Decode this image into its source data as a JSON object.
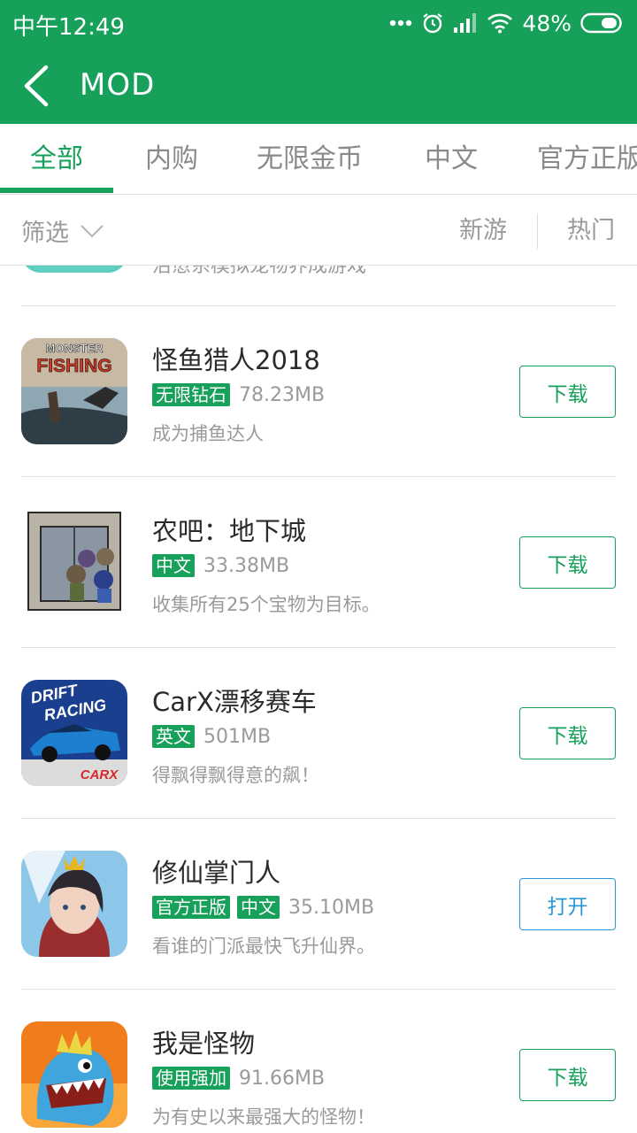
{
  "status_bar": {
    "time": "中午12:49",
    "battery": "48%",
    "icons": [
      "more-dots-icon",
      "alarm-icon",
      "signal-icon",
      "wifi-icon",
      "battery-icon"
    ]
  },
  "header": {
    "title": "MOD",
    "back_icon": "back-arrow-icon",
    "color": "#16a05a"
  },
  "tabs": [
    {
      "label": "全部",
      "active": true
    },
    {
      "label": "内购"
    },
    {
      "label": "无限金币"
    },
    {
      "label": "中文"
    },
    {
      "label": "官方正版"
    }
  ],
  "filter": {
    "label": "筛选",
    "icon": "chevron-down-icon",
    "sort_new": "新游",
    "sort_hot": "热门"
  },
  "partial_item": {
    "desc": "治愈系模拟宠物养成游戏"
  },
  "apps": [
    {
      "name": "怪鱼猎人2018",
      "tags": [
        "无限钻石"
      ],
      "size": "78.23MB",
      "desc": "成为捕鱼达人",
      "button": "下载",
      "icon_text": [
        "MONSTER",
        "FISHING"
      ]
    },
    {
      "name": "农吧：地下城",
      "tags": [
        "中文"
      ],
      "size": "33.38MB",
      "desc": "收集所有25个宝物为目标。",
      "button": "下载"
    },
    {
      "name": "CarX漂移赛车",
      "tags": [
        "英文"
      ],
      "size": "501MB",
      "desc": "得飘得飘得意的飙！",
      "button": "下载",
      "icon_text": [
        "DRIFT",
        "RACING",
        "CARX"
      ]
    },
    {
      "name": "修仙掌门人",
      "tags": [
        "官方正版",
        "中文"
      ],
      "size": "35.10MB",
      "desc": "看谁的门派最快飞升仙界。",
      "button": "打开"
    },
    {
      "name": "我是怪物",
      "tags": [
        "使用强加"
      ],
      "size": "91.66MB",
      "desc": "为有史以来最强大的怪物！",
      "button": "下载"
    }
  ]
}
